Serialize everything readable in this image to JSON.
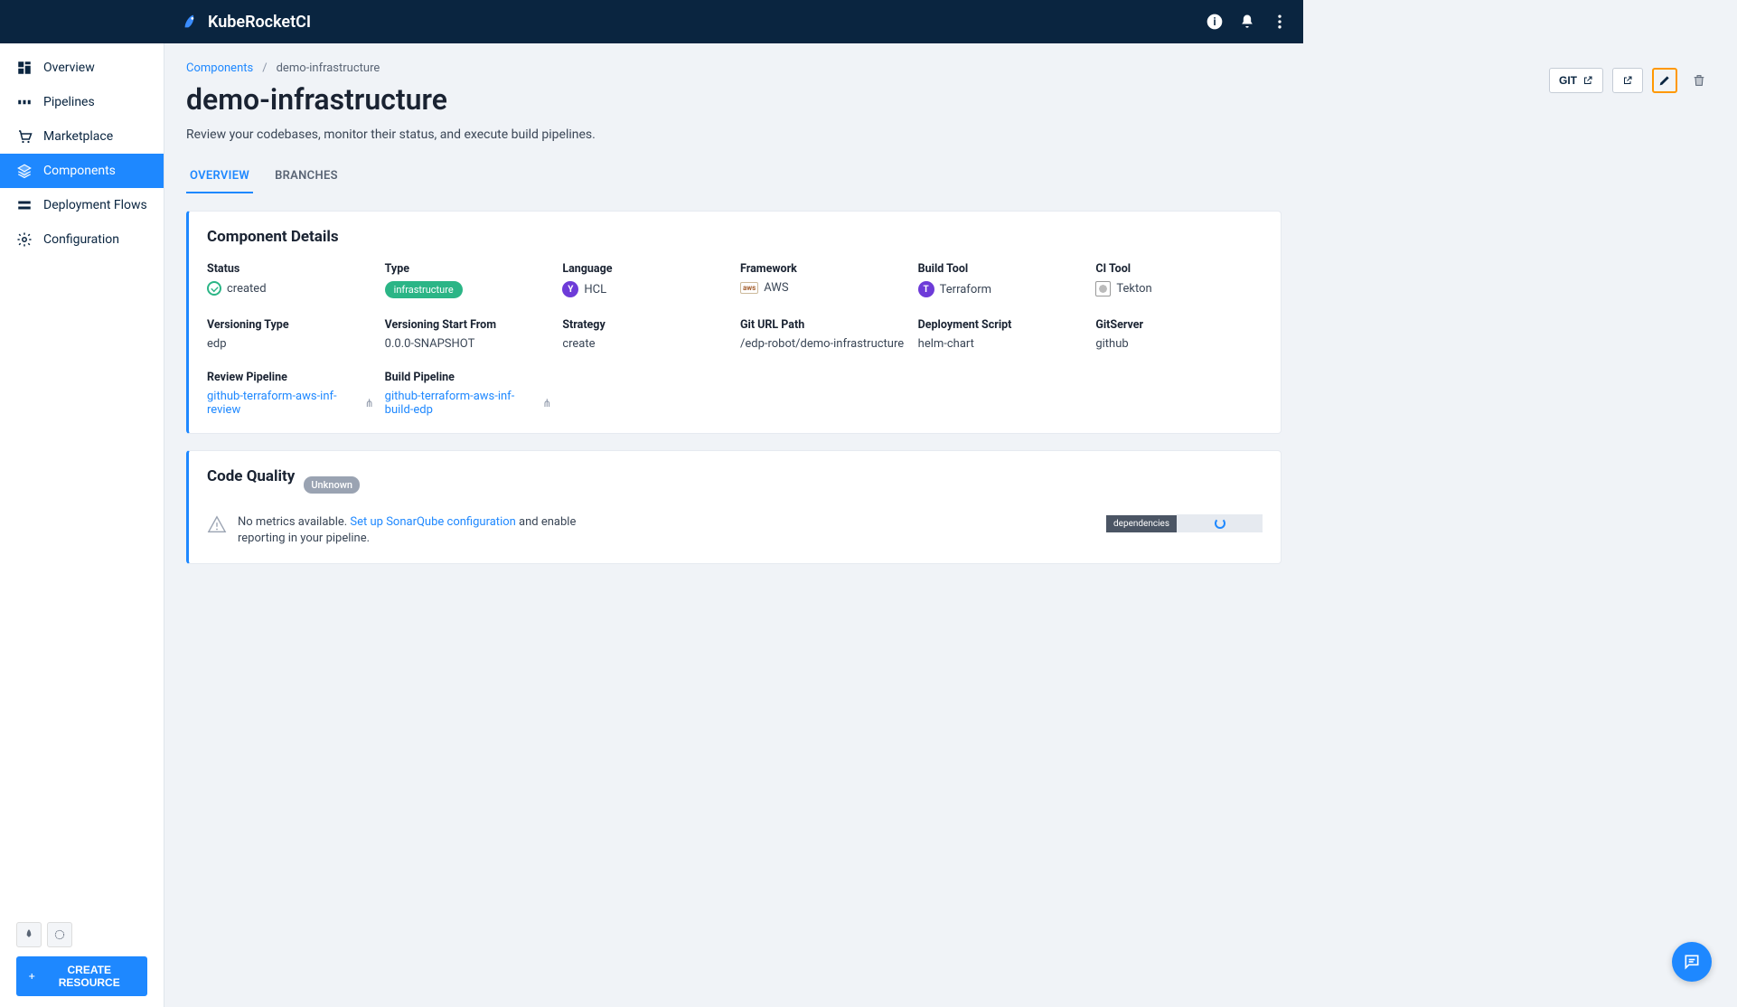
{
  "app": {
    "name": "KubeRocketCI"
  },
  "sidebar": {
    "items": [
      {
        "label": "Overview"
      },
      {
        "label": "Pipelines"
      },
      {
        "label": "Marketplace"
      },
      {
        "label": "Components"
      },
      {
        "label": "Deployment Flows"
      },
      {
        "label": "Configuration"
      }
    ],
    "create_label": "CREATE RESOURCE"
  },
  "breadcrumb": {
    "root": "Components",
    "current": "demo-infrastructure"
  },
  "page": {
    "title": "demo-infrastructure",
    "subtitle": "Review your codebases, monitor their status, and execute build pipelines."
  },
  "actions": {
    "git": "GIT"
  },
  "tabs": [
    {
      "label": "OVERVIEW"
    },
    {
      "label": "BRANCHES"
    }
  ],
  "details": {
    "heading": "Component Details",
    "fields": {
      "status": {
        "label": "Status",
        "value": "created"
      },
      "type": {
        "label": "Type",
        "value": "infrastructure"
      },
      "language": {
        "label": "Language",
        "value": "HCL"
      },
      "framework": {
        "label": "Framework",
        "value": "AWS"
      },
      "buildtool": {
        "label": "Build Tool",
        "value": "Terraform"
      },
      "citool": {
        "label": "CI Tool",
        "value": "Tekton"
      },
      "vertype": {
        "label": "Versioning Type",
        "value": "edp"
      },
      "verstart": {
        "label": "Versioning Start From",
        "value": "0.0.0-SNAPSHOT"
      },
      "strategy": {
        "label": "Strategy",
        "value": "create"
      },
      "gitpath": {
        "label": "Git URL Path",
        "value": "/edp-robot/demo-infrastructure"
      },
      "depscript": {
        "label": "Deployment Script",
        "value": "helm-chart"
      },
      "gitserver": {
        "label": "GitServer",
        "value": "github"
      },
      "reviewpipe": {
        "label": "Review Pipeline",
        "value": "github-terraform-aws-inf-review"
      },
      "buildpipe": {
        "label": "Build Pipeline",
        "value": "github-terraform-aws-inf-build-edp"
      }
    }
  },
  "codequality": {
    "heading": "Code Quality",
    "badge": "Unknown",
    "msg_pre": "No metrics available. ",
    "msg_link": "Set up SonarQube configuration",
    "msg_post": " and enable reporting in your pipeline.",
    "dep_label": "dependencies"
  }
}
